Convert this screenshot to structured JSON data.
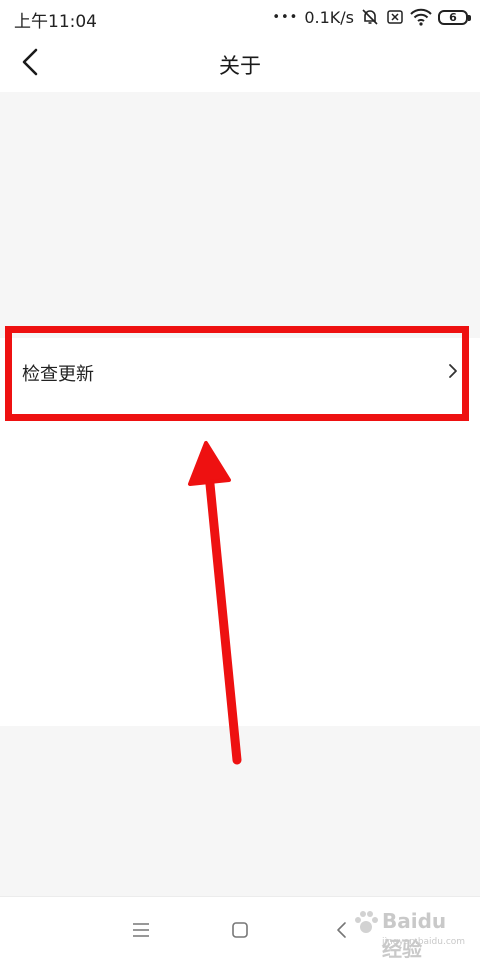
{
  "status_bar": {
    "time": "上午11:04",
    "dots": "•••",
    "speed": "0.1K/s",
    "battery": "6",
    "icons": [
      "mute-icon",
      "sim-x-icon",
      "wifi-icon",
      "battery-icon"
    ]
  },
  "header": {
    "title": "关于",
    "back_icon": "chevron-left-icon"
  },
  "list": {
    "items": [
      {
        "label": "检查更新",
        "icon": "chevron-right-icon"
      }
    ]
  },
  "annotation": {
    "highlight_color": "#ee1111",
    "arrow_color": "#ee1111"
  },
  "system_nav": {
    "icons": [
      "menu-icon",
      "home-icon",
      "back-icon"
    ]
  },
  "watermark": {
    "logo": "Baidu经验",
    "url": "jingyan.baidu.com"
  },
  "colors": {
    "background_gray": "#f6f6f6",
    "surface": "#ffffff",
    "text": "#1a1a1a"
  }
}
